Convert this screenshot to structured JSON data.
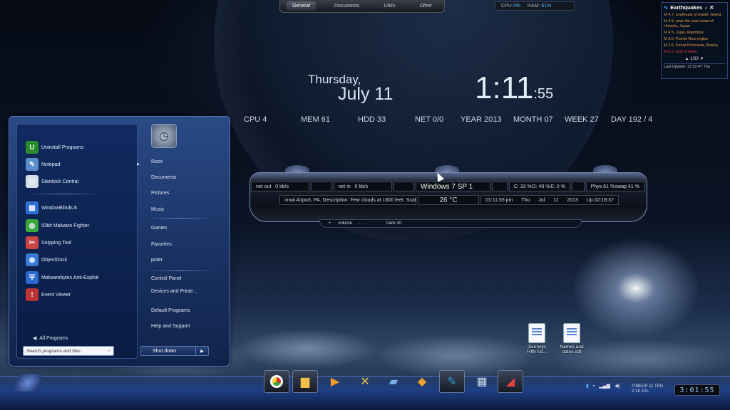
{
  "top_tabs": [
    "General",
    "Documents",
    "Links",
    "Other"
  ],
  "sysbar": {
    "cpu_label": "CPU:",
    "cpu_val": "3%",
    "ram_label": "RAM:",
    "ram_val": "61%"
  },
  "earthquakes": {
    "title": "Earthquakes",
    "items": [
      {
        "text": "M 4.7, southeast of Easter Island",
        "color": "#e3a04a"
      },
      {
        "text": "M 4.5, near the east coast of Honshu, Japan",
        "color": "#e3a04a"
      },
      {
        "text": "M 4.5, Jujuy, Argentina",
        "color": "#e3a04a"
      },
      {
        "text": "M 3.0, Puerto Rico region",
        "color": "#e3a04a"
      },
      {
        "text": "M 2.6, Kenai Peninsula, Alaska",
        "color": "#e3a04a"
      },
      {
        "text": "M 5.0, Gulf of Aden",
        "color": "#e0413a"
      }
    ],
    "pager": "1/33",
    "footer": "Last Update: 13:10:47 Thu"
  },
  "clock": {
    "day": "Thursday,",
    "date": "July  11",
    "hm": "1:11",
    "sec": ":55"
  },
  "stats": [
    "CPU 4",
    "MEM 61",
    "HDD 33",
    "NET 0/0",
    "YEAR 2013",
    "MONTH 07",
    "WEEK 27",
    "DAY 192  / 4"
  ],
  "start_menu": {
    "programs": [
      {
        "label": "Uninstall Programs",
        "icon": "uninstall-icon",
        "sym": "U",
        "bg": "#2a8a2a"
      },
      {
        "label": "Notepad",
        "icon": "notepad-icon",
        "sym": "✎",
        "bg": "#5a8ec8"
      },
      {
        "label": "Stardock Central",
        "icon": "stardock-icon",
        "sym": "▤",
        "bg": "#d6dee8"
      },
      {
        "label": "WindowBlinds 8",
        "icon": "windowblinds-icon",
        "sym": "▦",
        "bg": "#2f6fd6"
      },
      {
        "label": "IObit Malware Fighter",
        "icon": "iobit-icon",
        "sym": "◍",
        "bg": "#3aa83a"
      },
      {
        "label": "Snipping Tool",
        "icon": "scissors-icon",
        "sym": "✂",
        "bg": "#c44"
      },
      {
        "label": "ObjectDock",
        "icon": "objectdock-icon",
        "sym": "◉",
        "bg": "#3a7ad6"
      },
      {
        "label": "Malwarebytes Anti-Exploit",
        "icon": "malwarebytes-icon",
        "sym": "⛨",
        "bg": "#2a6ad0"
      },
      {
        "label": "Event Viewer",
        "icon": "event-viewer-icon",
        "sym": "!",
        "bg": "#b33"
      }
    ],
    "right": [
      "Ross",
      "Documents",
      "Pictures",
      "Music",
      "Games",
      "Favorites",
      "puter",
      "Control Panel",
      "Devices and Printe...",
      "Default Programs",
      "Help and Support"
    ],
    "all_programs": "All Programs",
    "search_placeholder": "Search programs and files",
    "shutdown": "Shut down"
  },
  "player": {
    "net_out": "net out",
    "net_out_val": "0 kb/s",
    "net_in": "net in",
    "net_in_val": "0 kb/s",
    "windows": "Windows 7   SP 1",
    "c": "C: 33 %",
    "d": "D: 48 %",
    "e": "E: 0 %",
    "phys": "Phys 61 %",
    "swap": "swap 41 %",
    "weather_text": "ional Airport, PA.  Description: Few clouds at 1600 feet. Scat",
    "temp": "26 °C",
    "time": "01:11:55 pm",
    "day": "Thu",
    "mon": "Jul",
    "dnum": "11",
    "year": "2013",
    "uptime": "Up  02:18:37",
    "plus": "+",
    "volume": "volume",
    "minus": "-",
    "track": "track #0"
  },
  "desktop_icons": [
    {
      "label": "Journeys Fifth Ed..."
    },
    {
      "label": "Names and dates.odt"
    }
  ],
  "tray": {
    "time_line1": "TIMEUP 11 TEN",
    "time_line2": "2:18    JUL",
    "digital": "3:01:55"
  }
}
